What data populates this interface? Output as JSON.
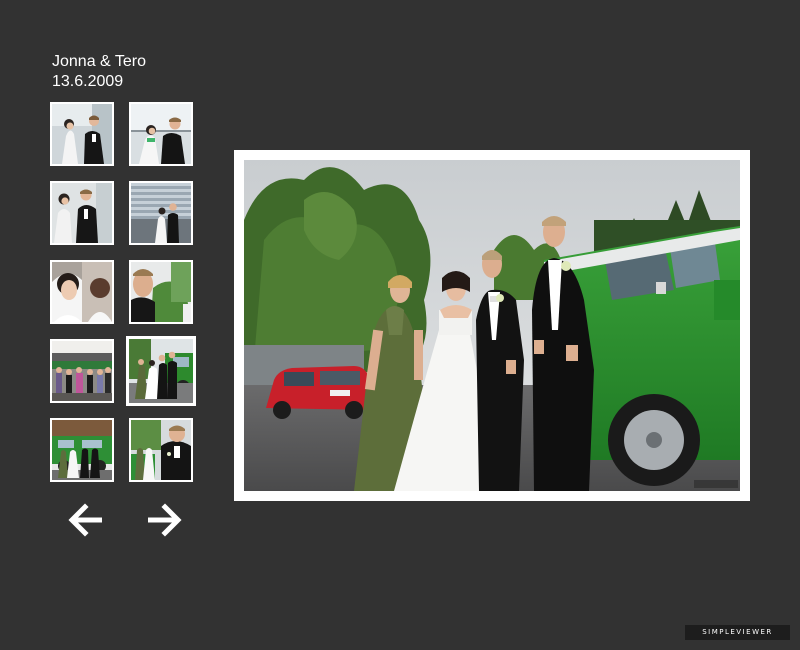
{
  "album": {
    "title": "Jonna & Tero",
    "date": "13.6.2009"
  },
  "thumbnails": [
    {
      "id": 1,
      "subject": "couple dancing, bride in white, groom in black suit"
    },
    {
      "id": 2,
      "subject": "couple dancing in front of window"
    },
    {
      "id": 3,
      "subject": "couple dancing close-up"
    },
    {
      "id": 4,
      "subject": "couple dancing by window blinds"
    },
    {
      "id": 5,
      "subject": "bride portrait with veil"
    },
    {
      "id": 6,
      "subject": "groom portrait outdoors"
    },
    {
      "id": 7,
      "subject": "group of guests outside building"
    },
    {
      "id": 8,
      "subject": "wedding party in front of green van",
      "active": true
    },
    {
      "id": 9,
      "subject": "wedding party walking by green van"
    },
    {
      "id": 10,
      "subject": "groom close-up with guests"
    }
  ],
  "navigation": {
    "previous_icon": "arrow-left-icon",
    "next_icon": "arrow-right-icon"
  },
  "main_image": {
    "subject": "bridesmaid, bride, groom and best man standing beside a green Volkswagen van and a red car"
  },
  "branding": {
    "badge_text": "SIMPLEVIEWER"
  },
  "colors": {
    "background": "#323232",
    "frame": "#ffffff",
    "van_green": "#2e8b2e",
    "car_red": "#c8202a",
    "foliage": "#3f6b2a"
  }
}
